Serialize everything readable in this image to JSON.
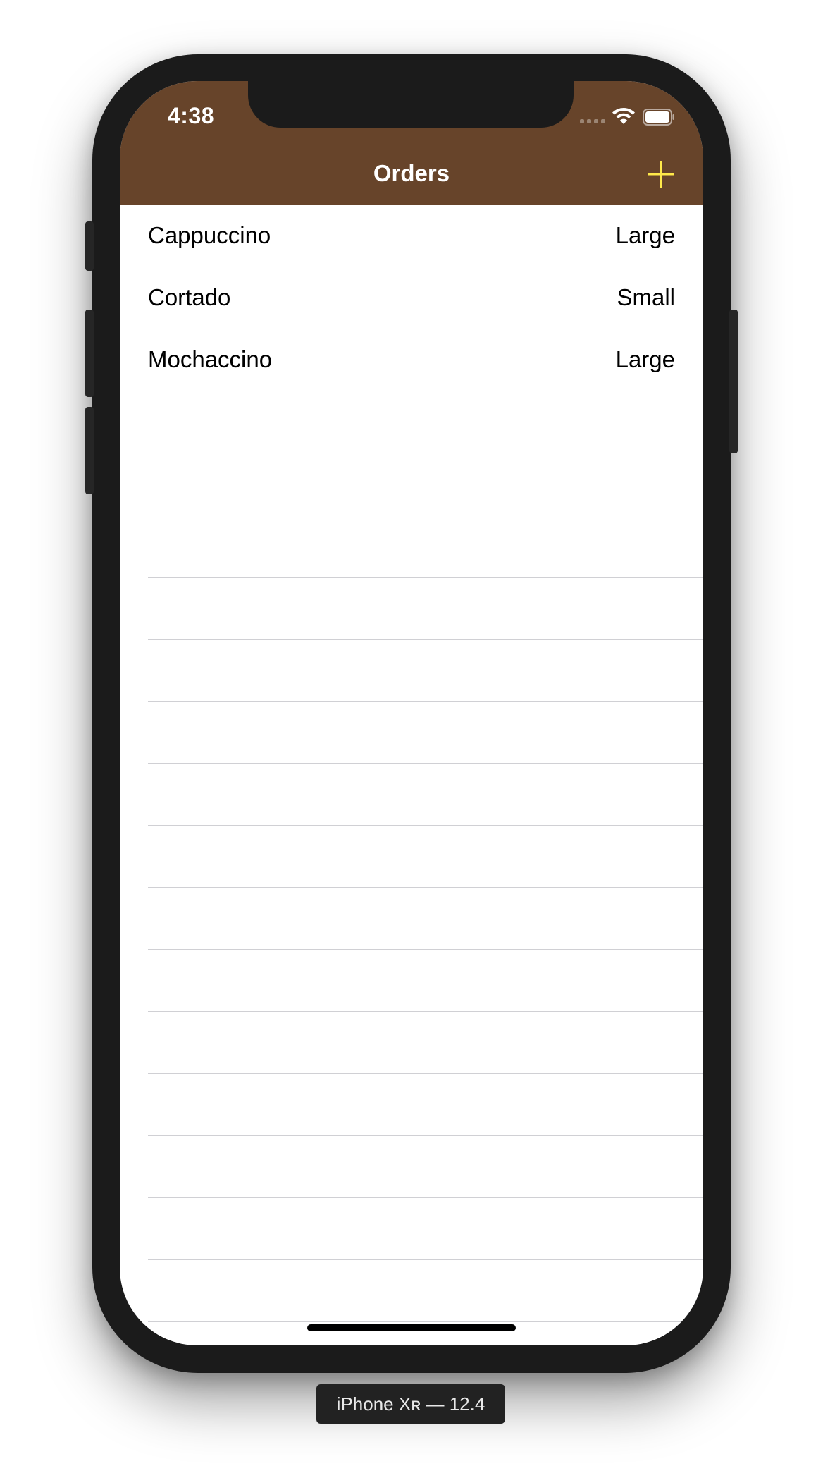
{
  "status_bar": {
    "time": "4:38",
    "icons": [
      "cellular-signal-icon",
      "wifi-icon",
      "battery-icon"
    ]
  },
  "nav_bar": {
    "title": "Orders",
    "add_icon": "plus-icon",
    "background_color": "#67442a",
    "accent_color": "#ffe94a"
  },
  "orders": [
    {
      "name": "Cappuccino",
      "size": "Large"
    },
    {
      "name": "Cortado",
      "size": "Small"
    },
    {
      "name": "Mochaccino",
      "size": "Large"
    }
  ],
  "device_label": "iPhone Xʀ — 12.4"
}
